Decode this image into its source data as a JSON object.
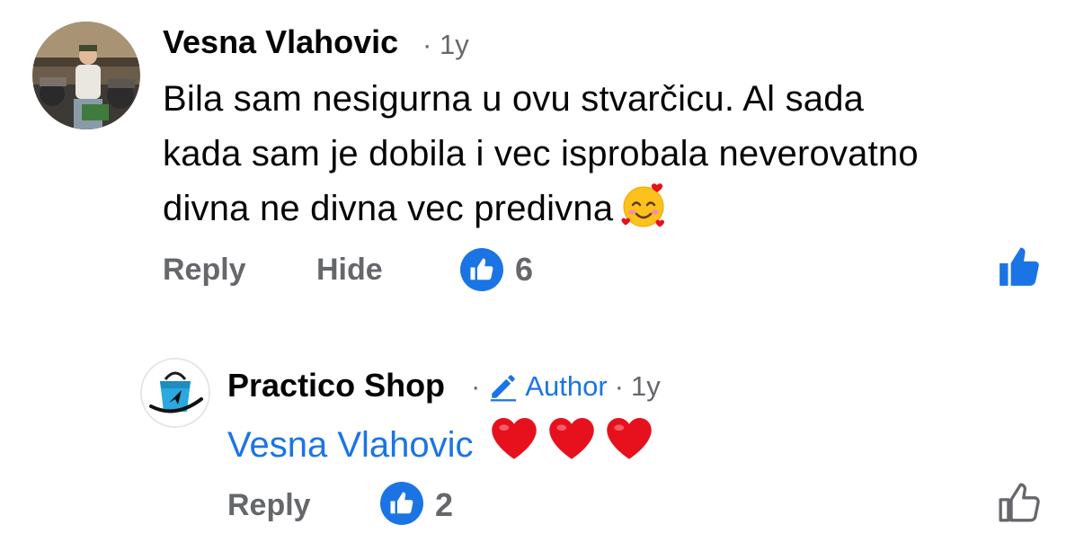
{
  "comment": {
    "author": "Vesna Vlahovic",
    "separator": "·",
    "time": "1y",
    "body_lines": [
      "Bila sam nesigurna u ovu stvarčicu. Al sada",
      "kada sam je dobila i vec isprobala neverovatno",
      "divna ne divna vec predivna"
    ],
    "emoji": "smiling-face-with-hearts",
    "actions": {
      "reply": "Reply",
      "hide": "Hide"
    },
    "like_count": "6",
    "liked": true
  },
  "reply": {
    "author": "Practico Shop",
    "separator": "·",
    "badge": "Author",
    "separator2": "·",
    "time": "1y",
    "mention": "Vesna Vlahovic",
    "hearts": 3,
    "actions": {
      "reply": "Reply"
    },
    "like_count": "2",
    "liked": false
  },
  "colors": {
    "accent": "#1b74e4",
    "muted": "#65676b",
    "text": "#050505",
    "heart": "#e6111d"
  }
}
